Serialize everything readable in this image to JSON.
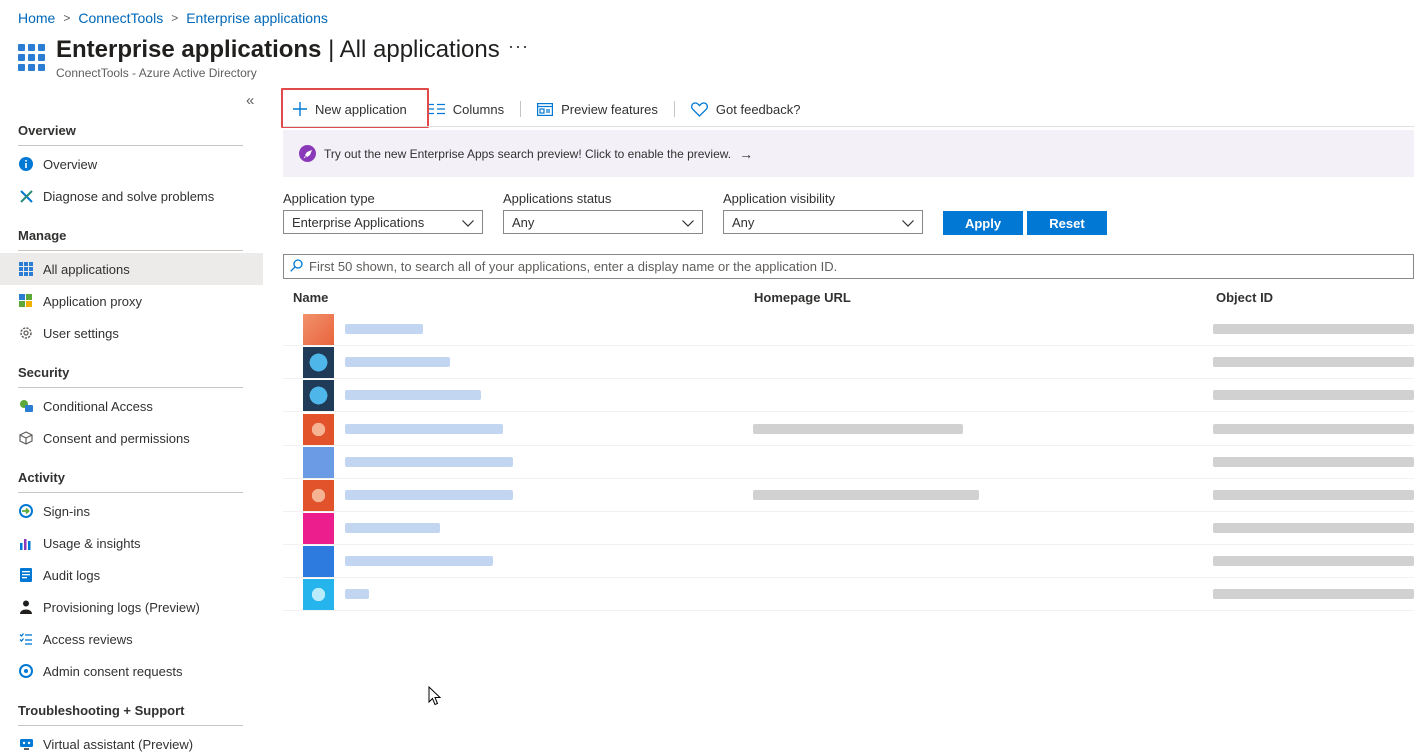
{
  "breadcrumb": [
    "Home",
    "ConnectTools",
    "Enterprise applications"
  ],
  "header": {
    "title_bold": "Enterprise applications",
    "title_light": " | All applications",
    "subtitle": "ConnectTools - Azure Active Directory",
    "more": "···"
  },
  "sidebar": {
    "collapse": "«",
    "sections": {
      "overview": "Overview",
      "manage": "Manage",
      "security": "Security",
      "activity": "Activity",
      "troubleshooting": "Troubleshooting + Support"
    },
    "items": {
      "overview": "Overview",
      "diagnose": "Diagnose and solve problems",
      "all_applications": "All applications",
      "application_proxy": "Application proxy",
      "user_settings": "User settings",
      "conditional_access": "Conditional Access",
      "consent_permissions": "Consent and permissions",
      "sign_ins": "Sign-ins",
      "usage_insights": "Usage & insights",
      "audit_logs": "Audit logs",
      "provisioning_logs": "Provisioning logs (Preview)",
      "access_reviews": "Access reviews",
      "admin_consent": "Admin consent requests",
      "virtual_assistant": "Virtual assistant (Preview)"
    }
  },
  "toolbar": {
    "new_application": "New application",
    "columns": "Columns",
    "preview_features": "Preview features",
    "feedback": "Got feedback?"
  },
  "banner": {
    "text": "Try out the new Enterprise Apps search preview! Click to enable the preview.",
    "arrow": "→"
  },
  "filters": {
    "application_type": {
      "label": "Application type",
      "value": "Enterprise Applications"
    },
    "applications_status": {
      "label": "Applications status",
      "value": "Any"
    },
    "application_visibility": {
      "label": "Application visibility",
      "value": "Any"
    },
    "apply": "Apply",
    "reset": "Reset"
  },
  "search": {
    "placeholder": "First 50 shown, to search all of your applications, enter a display name or the application ID."
  },
  "table": {
    "columns": [
      "Name",
      "Homepage URL",
      "Object ID"
    ]
  },
  "colors": {
    "accent": "#0078d4",
    "link": "#0067b8",
    "highlight": "#e04a4a",
    "banner_bg": "#f4f0f8"
  }
}
